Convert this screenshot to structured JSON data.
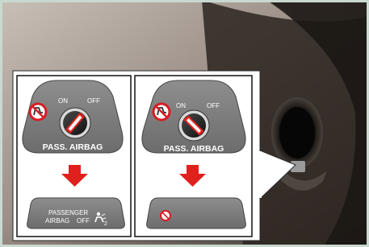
{
  "panel_left": {
    "switch_on_label": "ON",
    "switch_off_label": "OFF",
    "switch_plate_label": "PASS. AIRBAG",
    "indicator_line1": "PASSENGER",
    "indicator_line2": "AIRBAG",
    "indicator_line3": "OFF",
    "indicator_icon_suffix": "2"
  },
  "panel_right": {
    "switch_on_label": "ON",
    "switch_off_label": "OFF",
    "switch_plate_label": "PASS. AIRBAG"
  },
  "colors": {
    "frame": "#c9d9cf",
    "panel_bg": "#ffffff",
    "plate_gray": "#7c7c7c",
    "arrow_red": "#e0201c",
    "prohibit_red": "#d81c24"
  }
}
